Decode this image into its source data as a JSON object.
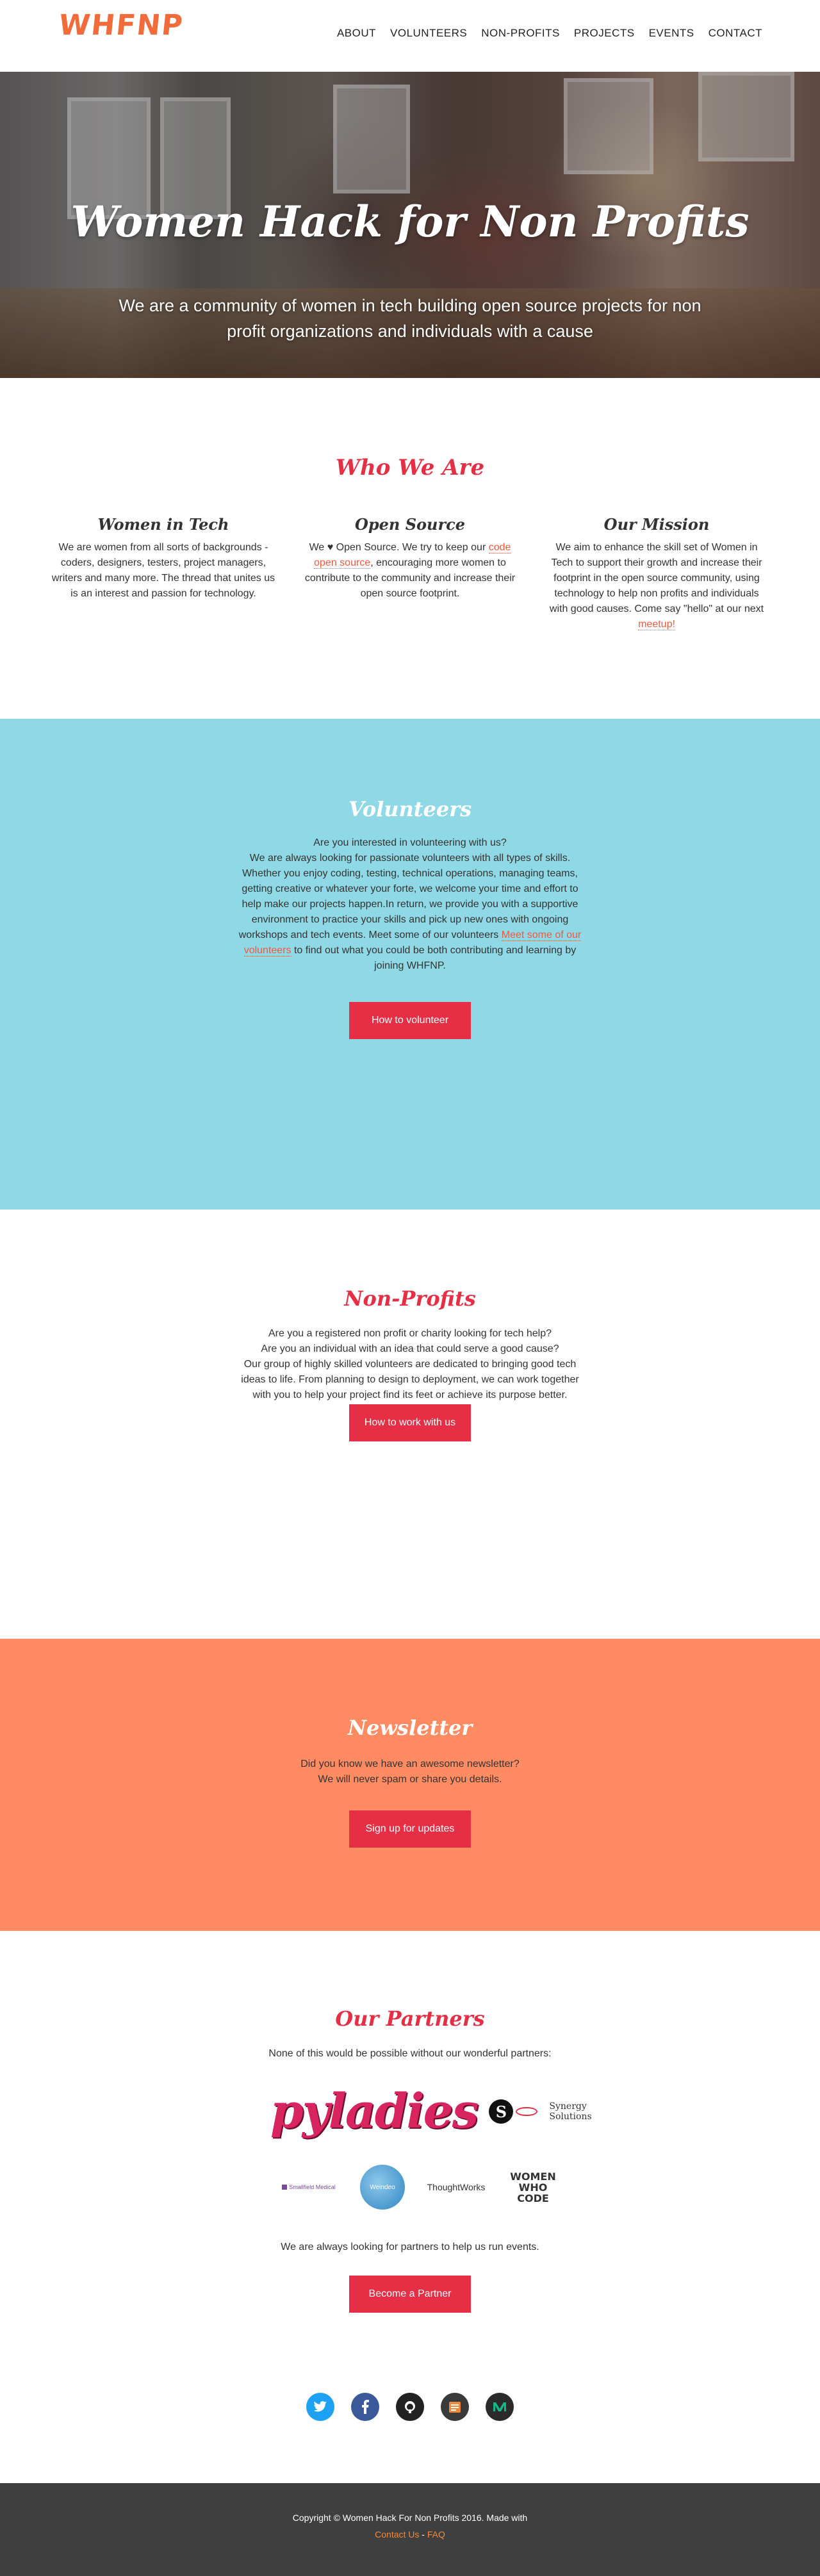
{
  "header": {
    "logo_text": "WHFNP",
    "nav": [
      "ABOUT",
      "VOLUNTEERS",
      "NON-PROFITS",
      "PROJECTS",
      "EVENTS",
      "CONTACT"
    ]
  },
  "hero": {
    "title": "Women Hack for Non Profits",
    "subtitle": "We are a community of women in tech building open source projects for non profit organizations and individuals with a cause"
  },
  "who": {
    "title": "Who We Are",
    "col1": {
      "title": "Women in Tech",
      "text": "We are women from all sorts of backgrounds - coders, designers, testers, project managers, writers and many more. The thread that unites us is an interest and passion for technology."
    },
    "col2": {
      "title": "Open Source",
      "text_a": "We ♥ Open Source. We try to keep our ",
      "link1": "code",
      "link2": "open source",
      "text_b": ", encouraging more women to contribute to the community and increase their open source footprint."
    },
    "col3": {
      "title": "Our Mission",
      "text_a": "We aim to enhance the skill set of Women in Tech to support their growth and increase their footprint in the open source community, using technology to help non profits and individuals with good causes. Come say \"hello\" at our next ",
      "link": "meetup!"
    }
  },
  "volunteers": {
    "title": "Volunteers",
    "text_a": "Are you interested in volunteering with us?\nWe are always looking for passionate volunteers with all types of skills. Whether you enjoy coding, testing, technical operations, managing teams, getting creative or whatever your forte, we welcome your time and effort to help make our projects happen.In return, we provide you with a supportive environment to practice your skills and pick up new ones with ongoing workshops and tech events. Meet some of our volunteers ",
    "link": "Meet some of our volunteers",
    "text_b": " to find out what you could be both contributing and learning by joining WHFNP.",
    "button": "How to volunteer"
  },
  "nonprofits": {
    "title": "Non-Profits",
    "text": "Are you a registered non profit or charity looking for tech help?\nAre you an individual with an idea that could serve a good cause?\nOur group of highly skilled volunteers are dedicated to bringing good tech ideas to life. From planning to design to deployment, we can work together with you to help your project find its feet or achieve its purpose better.",
    "button": "How to work with us"
  },
  "newsletter": {
    "title": "Newsletter",
    "text": "Did you know we have an awesome newsletter?\nWe will never spam or share you details.",
    "button": "Sign up for updates"
  },
  "partners": {
    "title": "Our Partners",
    "intro": "None of this would be possible without our wonderful partners:",
    "logos": [
      "pyladies",
      "S",
      "Synergy Solutions",
      "Smallfield Medical",
      "Weindeo",
      "ThoughtWorks",
      "WOMEN WHO CODE"
    ],
    "outro": "We are always looking for partners to help us run events.",
    "button": "Become a Partner"
  },
  "socials": [
    "twitter-icon",
    "facebook-icon",
    "github-icon",
    "blog-icon",
    "medium-icon"
  ],
  "footer": {
    "copyright": "Copyright © Women Hack For Non Profits 2016. Made with",
    "contact": "Contact Us",
    "sep": " - ",
    "faq": "FAQ"
  },
  "colors": {
    "accent": "#e62e45",
    "volunteers_bg": "#8fd9e6",
    "newsletter_bg": "#ff8b62",
    "footer_bg": "#3f3f3f",
    "logo": "#f26b3a"
  }
}
